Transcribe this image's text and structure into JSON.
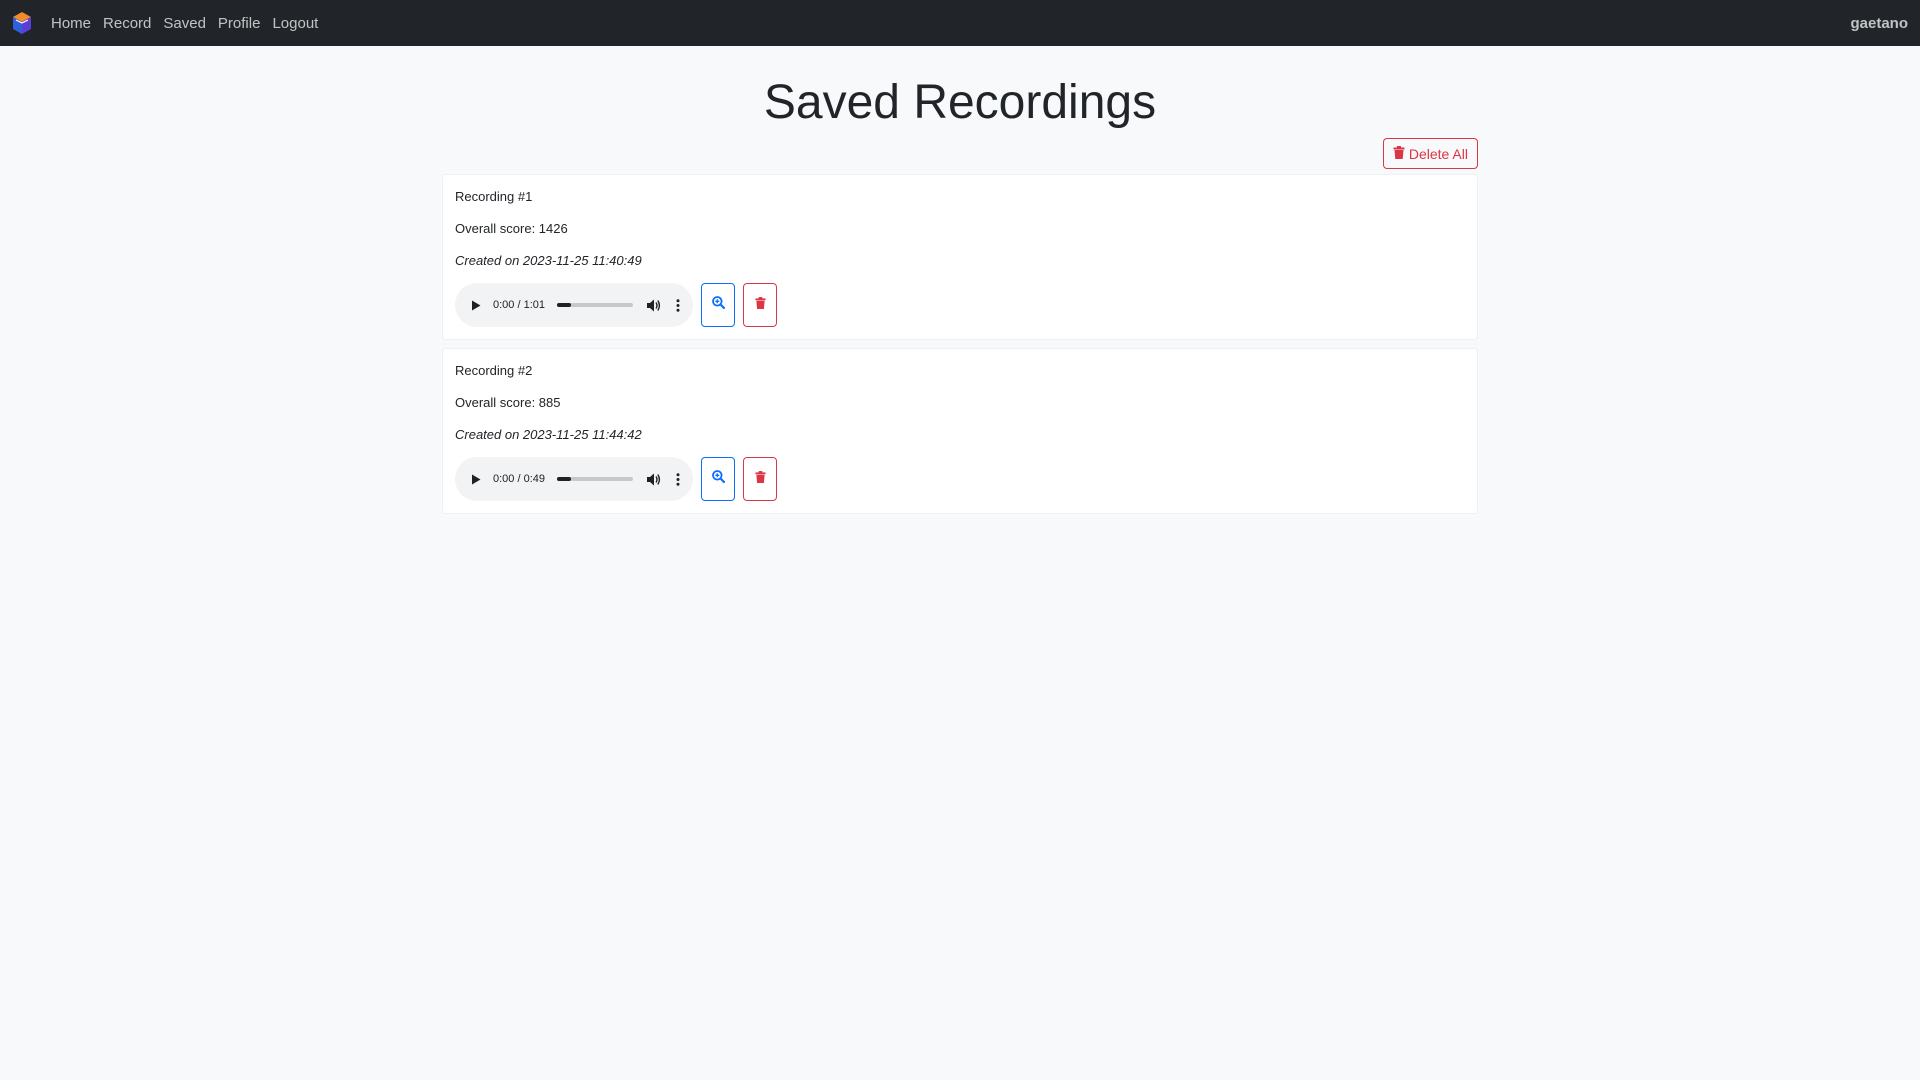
{
  "navbar": {
    "links": [
      "Home",
      "Record",
      "Saved",
      "Profile",
      "Logout"
    ],
    "username": "gaetano"
  },
  "page": {
    "title": "Saved Recordings",
    "delete_all_label": "Delete All"
  },
  "recordings": [
    {
      "title": "Recording #1",
      "score": "Overall score: 1426",
      "created": "Created on 2023-11-25 11:40:49",
      "player_time": "0:00 / 1:01"
    },
    {
      "title": "Recording #2",
      "score": "Overall score: 885",
      "created": "Created on 2023-11-25 11:44:42",
      "player_time": "0:00 / 0:49"
    }
  ],
  "colors": {
    "navbar_bg": "#212529",
    "primary": "#0d6efd",
    "danger": "#dc3545",
    "page_bg": "#f8f9fa"
  }
}
